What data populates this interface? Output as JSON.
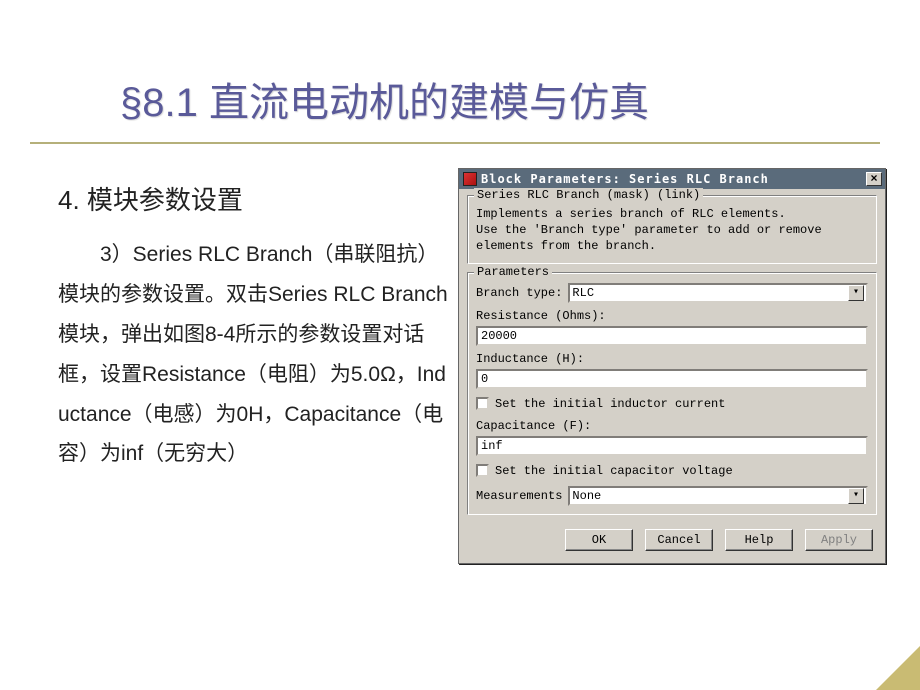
{
  "slide": {
    "title": "§8.1 直流电动机的建模与仿真",
    "heading": "4. 模块参数设置",
    "body": "3）Series RLC Branch（串联阻抗）模块的参数设置。双击Series RLC Branch模块，弹出如图8-4所示的参数设置对话框，设置Resistance（电阻）为5.0Ω，Inductance（电感）为0H，Capacitance（电容）为inf（无穷大）"
  },
  "dialog": {
    "title": "Block Parameters: Series RLC Branch",
    "group_desc_legend": "Series RLC Branch (mask) (link)",
    "description": "Implements a series branch of RLC elements.\nUse the 'Branch type' parameter to add or remove elements from the branch.",
    "group_param_legend": "Parameters",
    "labels": {
      "branch_type": "Branch type:",
      "resistance": "Resistance (Ohms):",
      "inductance": "Inductance (H):",
      "capacitance": "Capacitance (F):",
      "measurements": "Measurements"
    },
    "values": {
      "branch_type": "RLC",
      "resistance": "20000",
      "inductance": "0",
      "capacitance": "inf",
      "measurements": "None"
    },
    "checkboxes": {
      "inductor_current": "Set the initial inductor current",
      "capacitor_voltage": "Set the initial capacitor voltage"
    },
    "buttons": {
      "ok": "OK",
      "cancel": "Cancel",
      "help": "Help",
      "apply": "Apply"
    }
  }
}
